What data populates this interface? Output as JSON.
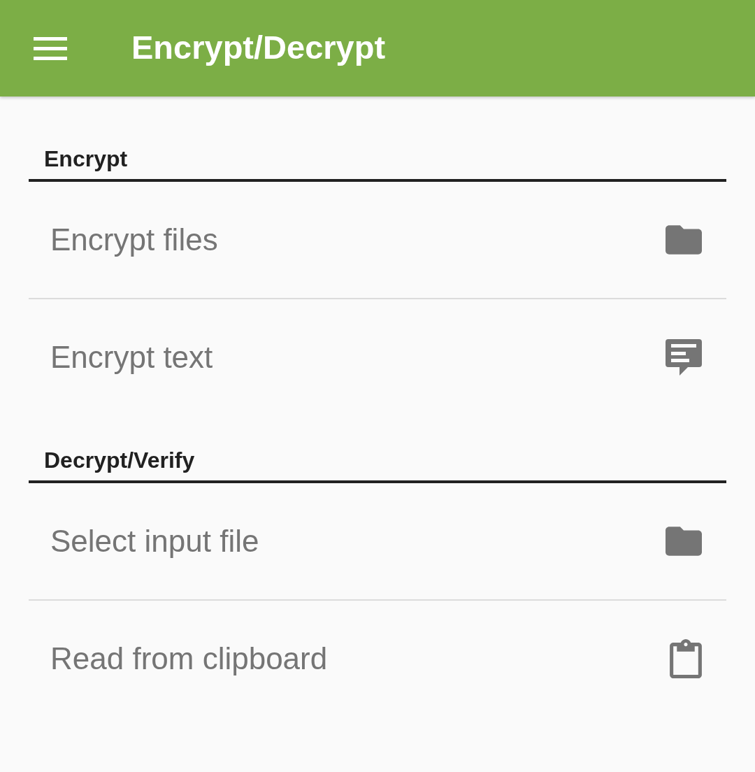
{
  "app_bar": {
    "title": "Encrypt/Decrypt"
  },
  "sections": [
    {
      "title": "Encrypt",
      "items": [
        {
          "label": "Encrypt files",
          "kind": "folder"
        },
        {
          "label": "Encrypt text",
          "kind": "message"
        }
      ]
    },
    {
      "title": "Decrypt/Verify",
      "items": [
        {
          "label": "Select input file",
          "kind": "folder"
        },
        {
          "label": "Read from clipboard",
          "kind": "clipboard"
        }
      ]
    }
  ]
}
